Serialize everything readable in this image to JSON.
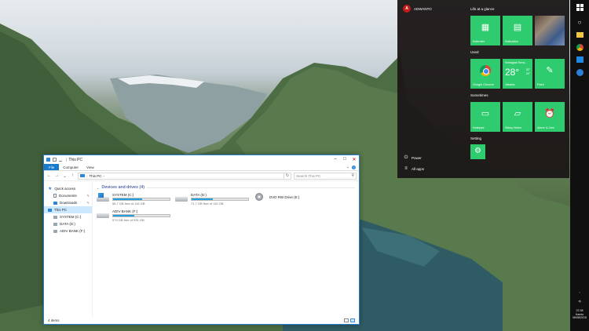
{
  "explorer": {
    "title": "This PC",
    "ribbon_tabs": [
      "File",
      "Computer",
      "View"
    ],
    "address": {
      "location": "This PC",
      "chevron": "›",
      "refresh": "↻"
    },
    "search_placeholder": "Search This PC",
    "nav_pane": [
      {
        "label": "Quick access",
        "icon": "star-icon",
        "pinned": false
      },
      {
        "label": "Documents",
        "icon": "documents-icon",
        "pinned": true
      },
      {
        "label": "Downloads",
        "icon": "downloads-icon",
        "pinned": true
      },
      {
        "label": "This PC",
        "icon": "pc-icon",
        "pinned": false,
        "selected": true
      },
      {
        "label": "SYSTEM (C:)",
        "icon": "drive-icon",
        "pinned": false
      },
      {
        "label": "DATA (D:)",
        "icon": "drive-icon",
        "pinned": false
      },
      {
        "label": "ADIV BANK (F:)",
        "icon": "network-drive-icon",
        "pinned": false
      }
    ],
    "group_title": "Devices and drives (4)",
    "drives": [
      {
        "name": "SYSTEM (C:)",
        "free": "56,7 GB free of 116 GB",
        "used_fraction": 0.51,
        "type": "system"
      },
      {
        "name": "DATA (D:)",
        "free": "71,7 GB free of 115 GB",
        "used_fraction": 0.38,
        "type": "disk"
      },
      {
        "name": "DVD RW Drive (E:)",
        "free": "",
        "used_fraction": null,
        "type": "dvd"
      },
      {
        "name": "ADIV BANK (F:)",
        "free": "579 GB free of 931 GB",
        "used_fraction": 0.38,
        "type": "disk"
      }
    ],
    "status": "4 items"
  },
  "start_menu": {
    "user": "ADWANTO",
    "sections": {
      "life": "Life at a glance",
      "used": "Used",
      "sometimes": "Sometimes",
      "setting": "Setting"
    },
    "tiles": {
      "calendar": "Kalender",
      "calculator": "Kalkulator",
      "chrome": "Google Chrome",
      "weather_city": "Sebagian Bera...",
      "weather_temp": "28°",
      "weather_high": "32°",
      "weather_low": "24°",
      "weather_location": "Jakarta",
      "paint": "Paint",
      "notepad": "Notepad",
      "sticky": "Sticky Notes",
      "alarm": "Alarm & Jam"
    },
    "power": "Power",
    "all_apps": "All apps"
  },
  "taskbar": {
    "tray_arrow": "‹",
    "volume": "◂)",
    "time": "22.38",
    "day": "Kamis",
    "date": "06/08/2015"
  },
  "colors": {
    "tile_green": "#2ecc6e",
    "explorer_accent": "#1979ca",
    "drive_bar": "#26a0da"
  }
}
